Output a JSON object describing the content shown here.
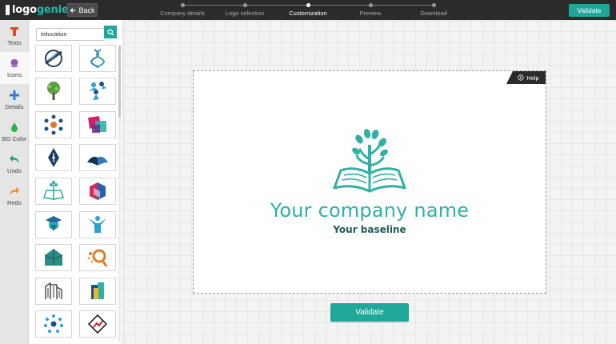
{
  "brand": {
    "part1": "logo",
    "part2": "genie",
    "color": "#1fb7a8"
  },
  "header": {
    "back_label": "Back",
    "steps": [
      {
        "label": "Company details",
        "active": false
      },
      {
        "label": "Logo selection",
        "active": false
      },
      {
        "label": "Customization",
        "active": true
      },
      {
        "label": "Preview",
        "active": false
      },
      {
        "label": "Download",
        "active": false
      }
    ],
    "validate_label": "Validate"
  },
  "tools": [
    {
      "label": "Texts",
      "icon": "text-t-icon",
      "active": false
    },
    {
      "label": "Icons",
      "icon": "icons-drop-icon",
      "active": true
    },
    {
      "label": "Details",
      "icon": "plus-icon",
      "active": false
    },
    {
      "label": "BG Color",
      "icon": "color-drop-icon",
      "active": false
    },
    {
      "label": "Undo",
      "icon": "undo-arrow-icon",
      "active": false
    },
    {
      "label": "Redo",
      "icon": "redo-arrow-icon",
      "active": false
    }
  ],
  "icon_panel": {
    "search_value": "education",
    "icons": [
      "globe-swoosh-icon",
      "dna-figure-icon",
      "green-tree-icon",
      "people-group-icon",
      "people-circle-icon",
      "color-squares-icon",
      "pen-nib-icon",
      "open-book-wave-icon",
      "book-tree-icon",
      "blue-cube-icon",
      "graduate-cap-icon",
      "raised-hands-icon",
      "house-gem-icon",
      "magnifier-dots-icon",
      "building-columns-icon",
      "stacked-books-icon",
      "dots-circle-icon",
      "diamond-chart-icon"
    ]
  },
  "canvas": {
    "help_label": "Help",
    "company_name": "Your company name",
    "baseline": "Your baseline",
    "logo_icon": "book-tree-icon",
    "accent_color": "#2fb0a6"
  },
  "footer": {
    "validate_label": "Validate"
  }
}
